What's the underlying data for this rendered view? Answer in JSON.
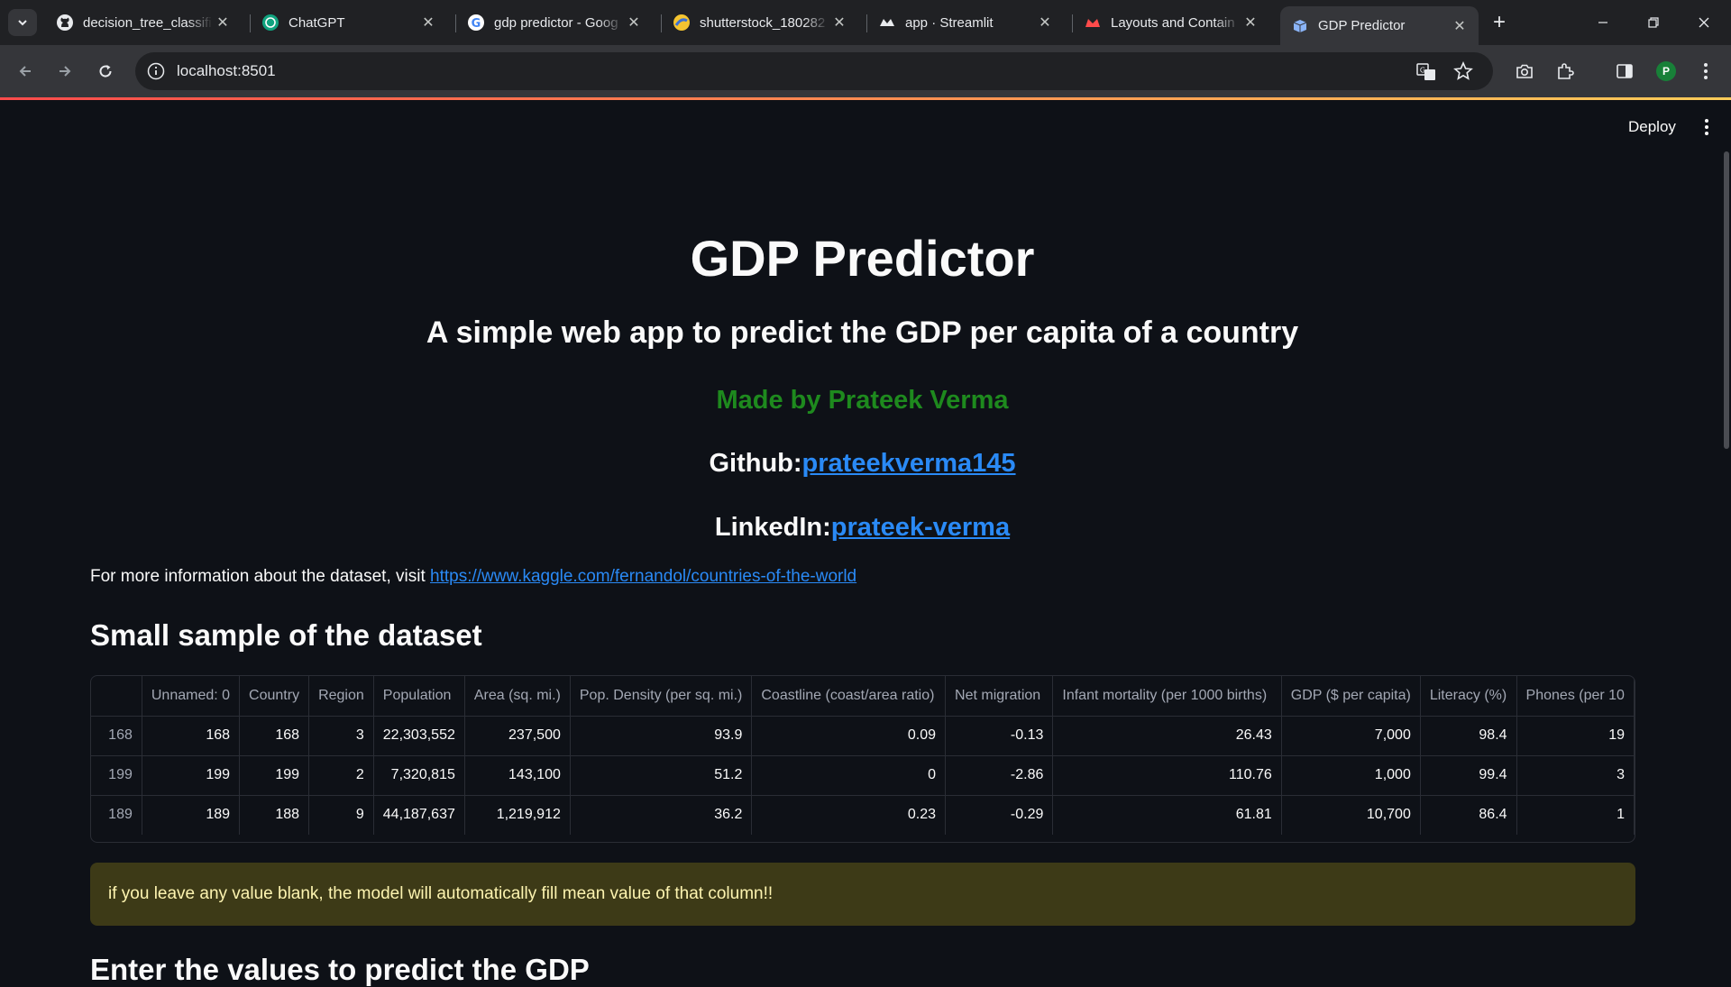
{
  "browser": {
    "tabs": [
      {
        "title": "decision_tree_classifi",
        "icon": "github-icon"
      },
      {
        "title": "ChatGPT",
        "icon": "chatgpt-icon"
      },
      {
        "title": "gdp predictor - Goog",
        "icon": "google-icon"
      },
      {
        "title": "shutterstock_180282",
        "icon": "image-icon"
      },
      {
        "title": "app · Streamlit",
        "icon": "streamlit-icon"
      },
      {
        "title": "Layouts and Contain",
        "icon": "streamlit-icon"
      },
      {
        "title": "GDP Predictor",
        "icon": "streamlit-icon",
        "active": true
      }
    ],
    "url": "localhost:8501",
    "profile_initial": "P"
  },
  "header": {
    "deploy_label": "Deploy"
  },
  "main": {
    "title": "GDP Predictor",
    "subtitle": "A simple web app to predict the GDP per capita of a country",
    "made_by": "Made by Prateek Verma",
    "github_label": "Github:",
    "github_link": "prateekverma145",
    "linkedin_label": "LinkedIn:",
    "linkedin_link": "prateek-verma",
    "info_text": "For more information about the dataset, visit ",
    "info_link": "https://www.kaggle.com/fernandol/countries-of-the-world",
    "sample_title": "Small sample of the dataset",
    "warning": "if you leave any value blank, the model will automatically fill mean value of that column!!",
    "next_heading": "Enter the values to predict the GDP"
  },
  "table": {
    "columns": [
      "",
      "Unnamed: 0",
      "Country",
      "Region",
      "Population",
      "Area (sq. mi.)",
      "Pop. Density (per sq. mi.)",
      "Coastline (coast/area ratio)",
      "Net migration",
      "Infant mortality (per 1000 births)",
      "GDP ($ per capita)",
      "Literacy (%)",
      "Phones (per 10"
    ],
    "rows": [
      [
        "168",
        "168",
        "168",
        "3",
        "22,303,552",
        "237,500",
        "93.9",
        "0.09",
        "-0.13",
        "26.43",
        "7,000",
        "98.4",
        "19"
      ],
      [
        "199",
        "199",
        "199",
        "2",
        "7,320,815",
        "143,100",
        "51.2",
        "0",
        "-2.86",
        "110.76",
        "1,000",
        "99.4",
        "3"
      ],
      [
        "189",
        "189",
        "188",
        "9",
        "44,187,637",
        "1,219,912",
        "36.2",
        "0.23",
        "-0.29",
        "61.81",
        "10,700",
        "86.4",
        "1"
      ]
    ]
  },
  "colors": {
    "accent_link": "#2a8af6",
    "made_by_green": "#1e8a1e",
    "warning_bg": "#3d3a17"
  }
}
